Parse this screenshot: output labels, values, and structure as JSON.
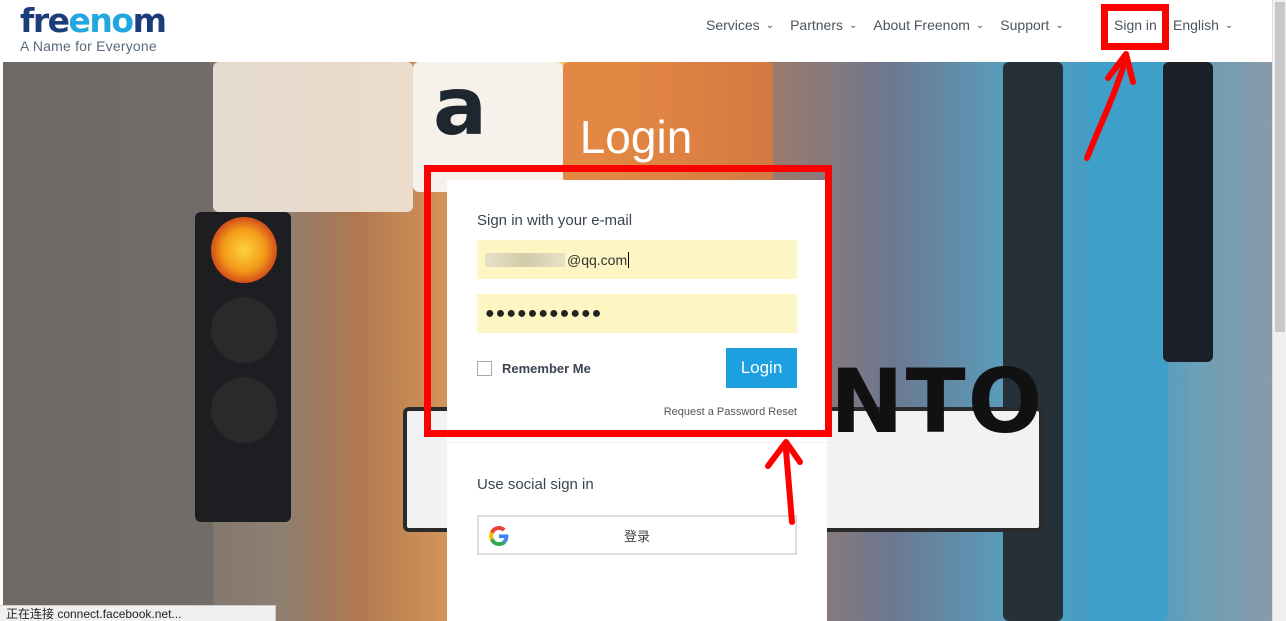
{
  "header": {
    "logo_text": "freenom",
    "tagline": "A Name for Everyone",
    "nav": [
      {
        "label": "Services"
      },
      {
        "label": "Partners"
      },
      {
        "label": "About Freenom"
      },
      {
        "label": "Support"
      }
    ],
    "sign_in": "Sign in",
    "language": "English"
  },
  "hero": {
    "title": "Login",
    "bg_letter": "a",
    "bg_sign_text": "NTO"
  },
  "login_card": {
    "heading": "Sign in with your e-mail",
    "email_value_visible": "@qq.com",
    "password_value": "●●●●●●●●●●●",
    "remember_label": "Remember Me",
    "remember_checked": false,
    "login_button": "Login",
    "reset_link": "Request a Password Reset",
    "social_heading": "Use social sign in",
    "google_button": "登录"
  },
  "status_bar": "正在连接 connect.facebook.net...",
  "colors": {
    "brand_dark": "#1d3d7a",
    "brand_light": "#22a7e0",
    "login_button": "#1e9fe0",
    "field_bg": "#fdf6c3",
    "annotation": "#ff0000"
  }
}
